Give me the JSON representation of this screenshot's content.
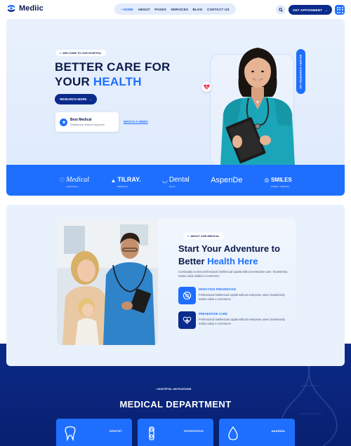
{
  "header": {
    "logo_text": "Mediic",
    "nav": [
      "HOME",
      "ABOUT",
      "PAGES",
      "SERVICES",
      "BLOG",
      "CONTACT US"
    ],
    "active_nav": "HOME",
    "cta_label": "GET APPOINMENT"
  },
  "hero": {
    "badge": "WELCOME TO OUR HOSPITAL",
    "title_line1": "BETTER CARE FOR",
    "title_line2_prefix": "YOUR ",
    "title_line2_highlight": "HEALTH",
    "research_button": "RESEARCH MORE",
    "best_title": "Best Medical",
    "best_sub": "Rapidiously network long-tools",
    "watch_link": "WATCH A VIDEO",
    "vertical_badge": "30+ RESEARCH CENTER",
    "brands": [
      {
        "name": "Medical",
        "sub": "Healthcare"
      },
      {
        "name": "TILRAY.",
        "sub": "MEDICAL"
      },
      {
        "name": "Dental",
        "sub": "Clinic"
      },
      {
        "name": "AspenDe",
        "sub": ""
      },
      {
        "name": "SMILES",
        "sub": "FAMILY DENTAL"
      }
    ]
  },
  "about": {
    "badge": "ABOUT OUR MEDICAL",
    "title_line1": "Start Your Adventure to",
    "title_line2_prefix": "Better ",
    "title_line2_highlight": "Health Here",
    "description": "Continually evolve professional intellectual capital without enterprise user. Seamlessly matrix value added e-commerce",
    "features": [
      {
        "title": "INFECTION PREVENTION",
        "desc": "Professional intellectual capital without enterprise users Seamlessly matrix value e-commerce"
      },
      {
        "title": "PREVENTIVE CARE",
        "desc": "Professional intellectual capital without enterprise users Seamlessly matrix value e-commerce"
      }
    ]
  },
  "department": {
    "badge": "HOSTIPTAL MOTIVATIONS",
    "title": "MEDICAL DEPARTMENT",
    "cards": [
      "DENTIST",
      "OSTEOPATHS",
      "ANAEMIA"
    ]
  },
  "colors": {
    "primary": "#1f6fff",
    "navy": "#0a2a8c",
    "dark_text": "#0c1a4b",
    "light_bg": "#e9f1fd",
    "teal_scrub": "#1aa6b8"
  }
}
